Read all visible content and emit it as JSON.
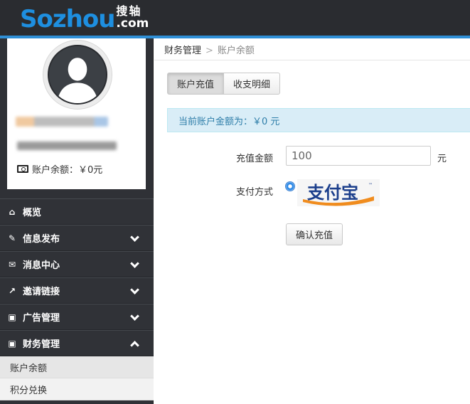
{
  "header": {
    "logo_main": "Sozhou",
    "logo_cn": "搜轴",
    "logo_com": ".com",
    "accent_color": "#2f8fd6"
  },
  "profile": {
    "avatar_icon": "user-silhouette-icon",
    "balance_label": "账户余额：￥0元"
  },
  "sidebar": {
    "items": [
      {
        "label": "概览",
        "icon": "home-icon"
      },
      {
        "label": "信息发布",
        "icon": "edit-icon"
      },
      {
        "label": "消息中心",
        "icon": "envelope-icon"
      },
      {
        "label": "邀请链接",
        "icon": "share-icon"
      },
      {
        "label": "广告管理",
        "icon": "money-icon"
      },
      {
        "label": "财务管理",
        "icon": "money-icon"
      }
    ],
    "subitems": [
      {
        "label": "账户余额"
      },
      {
        "label": "积分兑换"
      }
    ]
  },
  "breadcrumb": {
    "parent": "财务管理",
    "separator": ">",
    "current": "账户余额"
  },
  "tabs": [
    {
      "label": "账户充值"
    },
    {
      "label": "收支明细"
    }
  ],
  "alert": {
    "text": "当前账户金额为：￥0 元"
  },
  "form": {
    "amount_label": "充值金额",
    "amount_value": "100",
    "unit": "元",
    "payment_label": "支付方式",
    "payment_option": "支付宝",
    "submit_label": "确认充值"
  }
}
